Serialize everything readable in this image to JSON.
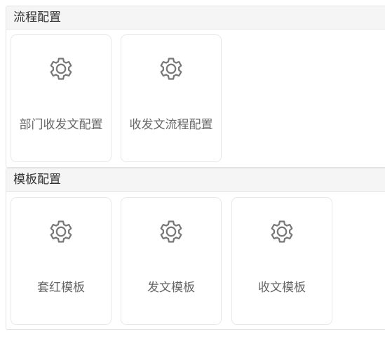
{
  "sections": [
    {
      "title": "流程配置",
      "items": [
        {
          "label": "部门收发文配置",
          "icon": "gear-icon"
        },
        {
          "label": "收发文流程配置",
          "icon": "gear-icon"
        }
      ]
    },
    {
      "title": "模板配置",
      "items": [
        {
          "label": "套红模板",
          "icon": "gear-icon"
        },
        {
          "label": "发文模板",
          "icon": "gear-icon"
        },
        {
          "label": "收文模板",
          "icon": "gear-icon"
        }
      ]
    }
  ],
  "colors": {
    "header_bg": "#f5f5f5",
    "border": "#e3e3e3",
    "card_border": "#e8e8e8",
    "icon_stroke": "#777777",
    "label_text": "#666666",
    "title_text": "#333333"
  }
}
